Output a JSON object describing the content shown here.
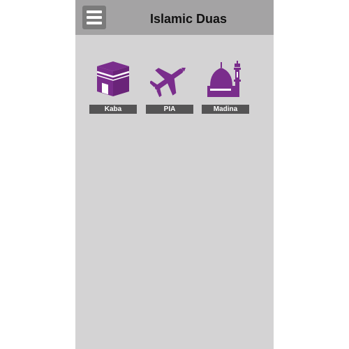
{
  "app": {
    "title": "Islamic Duas"
  },
  "colors": {
    "accent": "#7a2d8c",
    "appbar": "#a4a3a4",
    "background": "#d4d3d4",
    "label_bg": "#555455"
  },
  "tiles": [
    {
      "label": "Kaba",
      "icon": "kaaba-icon"
    },
    {
      "label": "PIA",
      "icon": "airplane-icon"
    },
    {
      "label": "Madina",
      "icon": "mosque-icon"
    }
  ]
}
